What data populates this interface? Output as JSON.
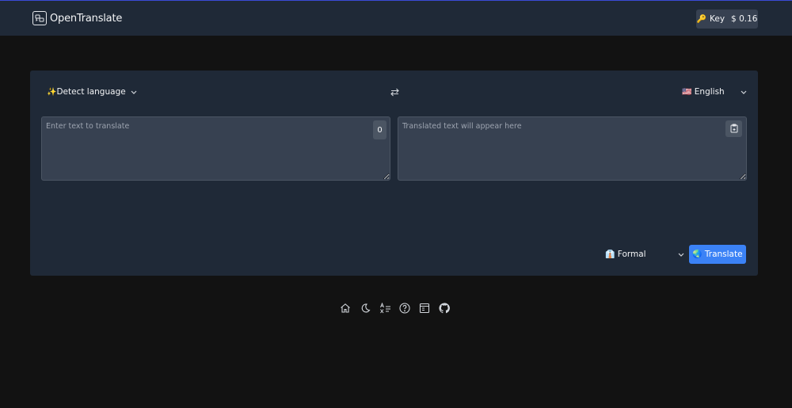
{
  "header": {
    "app_name": "OpenTranslate",
    "key_button": {
      "icon": "key-emoji",
      "label": "Key",
      "balance": "$ 0.16"
    }
  },
  "translator": {
    "source_language": {
      "emoji": "✨",
      "label": "Detect language"
    },
    "target_language": {
      "flag": "🇺🇸",
      "label": "English"
    },
    "input": {
      "value": "",
      "placeholder": "Enter text to translate",
      "char_count": "0"
    },
    "output": {
      "value": "",
      "placeholder": "Translated text will appear here"
    },
    "tone": {
      "emoji": "👔",
      "label": "Formal"
    },
    "translate_button": {
      "emoji": "🌏",
      "label": "Translate"
    }
  },
  "footer": {
    "icons": [
      "home-icon",
      "moon-icon",
      "language-icon",
      "help-icon",
      "layout-icon",
      "github-icon"
    ]
  },
  "colors": {
    "background": "#121212",
    "surface": "#1f2937",
    "field": "#374151",
    "accent": "#3b82f6",
    "top_border": "#3b4bd8"
  }
}
